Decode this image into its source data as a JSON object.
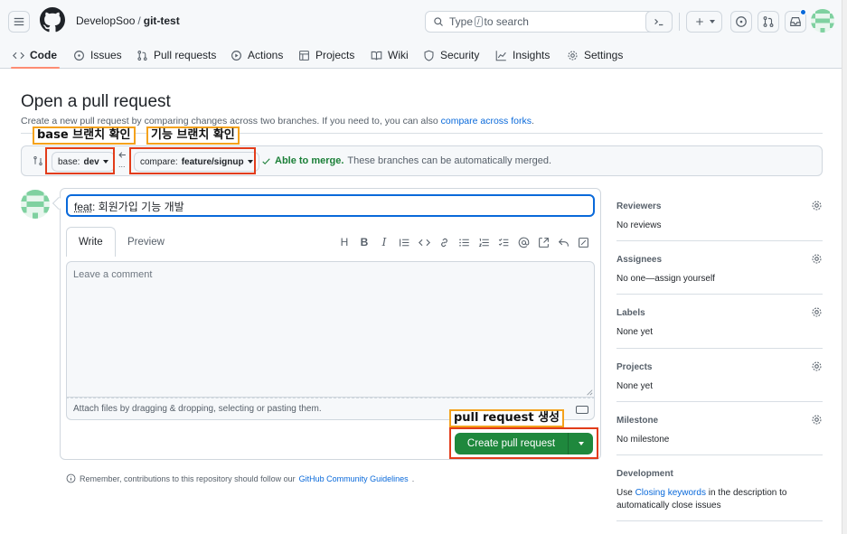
{
  "header": {
    "owner": "DevelopSoo",
    "separator": "/",
    "repo": "git-test",
    "search_prefix": "Type",
    "search_key": "/",
    "search_suffix": "to search"
  },
  "nav": {
    "tabs": [
      {
        "label": "Code",
        "icon": "code-icon"
      },
      {
        "label": "Issues",
        "icon": "issue-icon"
      },
      {
        "label": "Pull requests",
        "icon": "git-pull-request-icon"
      },
      {
        "label": "Actions",
        "icon": "play-icon"
      },
      {
        "label": "Projects",
        "icon": "table-icon"
      },
      {
        "label": "Wiki",
        "icon": "book-icon"
      },
      {
        "label": "Security",
        "icon": "shield-icon"
      },
      {
        "label": "Insights",
        "icon": "graph-icon"
      },
      {
        "label": "Settings",
        "icon": "gear-icon"
      }
    ]
  },
  "page": {
    "title": "Open a pull request",
    "subtitle": "Create a new pull request by comparing changes across two branches. If you need to, you can also",
    "subtitle_link": "compare across forks",
    "subtitle_end": "."
  },
  "annotations": {
    "base": "base 브랜치 확인",
    "feature": "기능 브랜치 확인",
    "create": "pull request 생성"
  },
  "compare": {
    "base_prefix": "base:",
    "base_value": "dev",
    "compare_prefix": "compare:",
    "compare_value": "feature/signup",
    "ellipsis": "...",
    "merge_ok": "Able to merge.",
    "merge_text": "These branches can be automatically merged."
  },
  "form": {
    "title_underlined": "feat",
    "title_rest": ": 회원가입 기능 개발",
    "tab_write": "Write",
    "tab_preview": "Preview",
    "heading_tool": "H",
    "bold_tool": "B",
    "italic_tool": "I",
    "comment_placeholder": "Leave a comment",
    "attach_text": "Attach files by dragging & dropping, selecting or pasting them.",
    "create_button": "Create pull request",
    "reminder": "Remember, contributions to this repository should follow our",
    "reminder_link": "GitHub Community Guidelines",
    "reminder_end": "."
  },
  "sidebar": {
    "reviewers": {
      "title": "Reviewers",
      "value": "No reviews"
    },
    "assignees": {
      "title": "Assignees",
      "value": "No one—assign yourself"
    },
    "labels": {
      "title": "Labels",
      "value": "None yet"
    },
    "projects": {
      "title": "Projects",
      "value": "None yet"
    },
    "milestone": {
      "title": "Milestone",
      "value": "No milestone"
    },
    "development": {
      "title": "Development",
      "prefix": "Use",
      "link": "Closing keywords",
      "suffix": "in the description to automatically close issues"
    }
  },
  "colors": {
    "accent": "#0969da",
    "success": "#1f883d",
    "underline": "#fd8c73",
    "annotation_orange": "#f4a21c",
    "annotation_red": "#e23c1a"
  }
}
